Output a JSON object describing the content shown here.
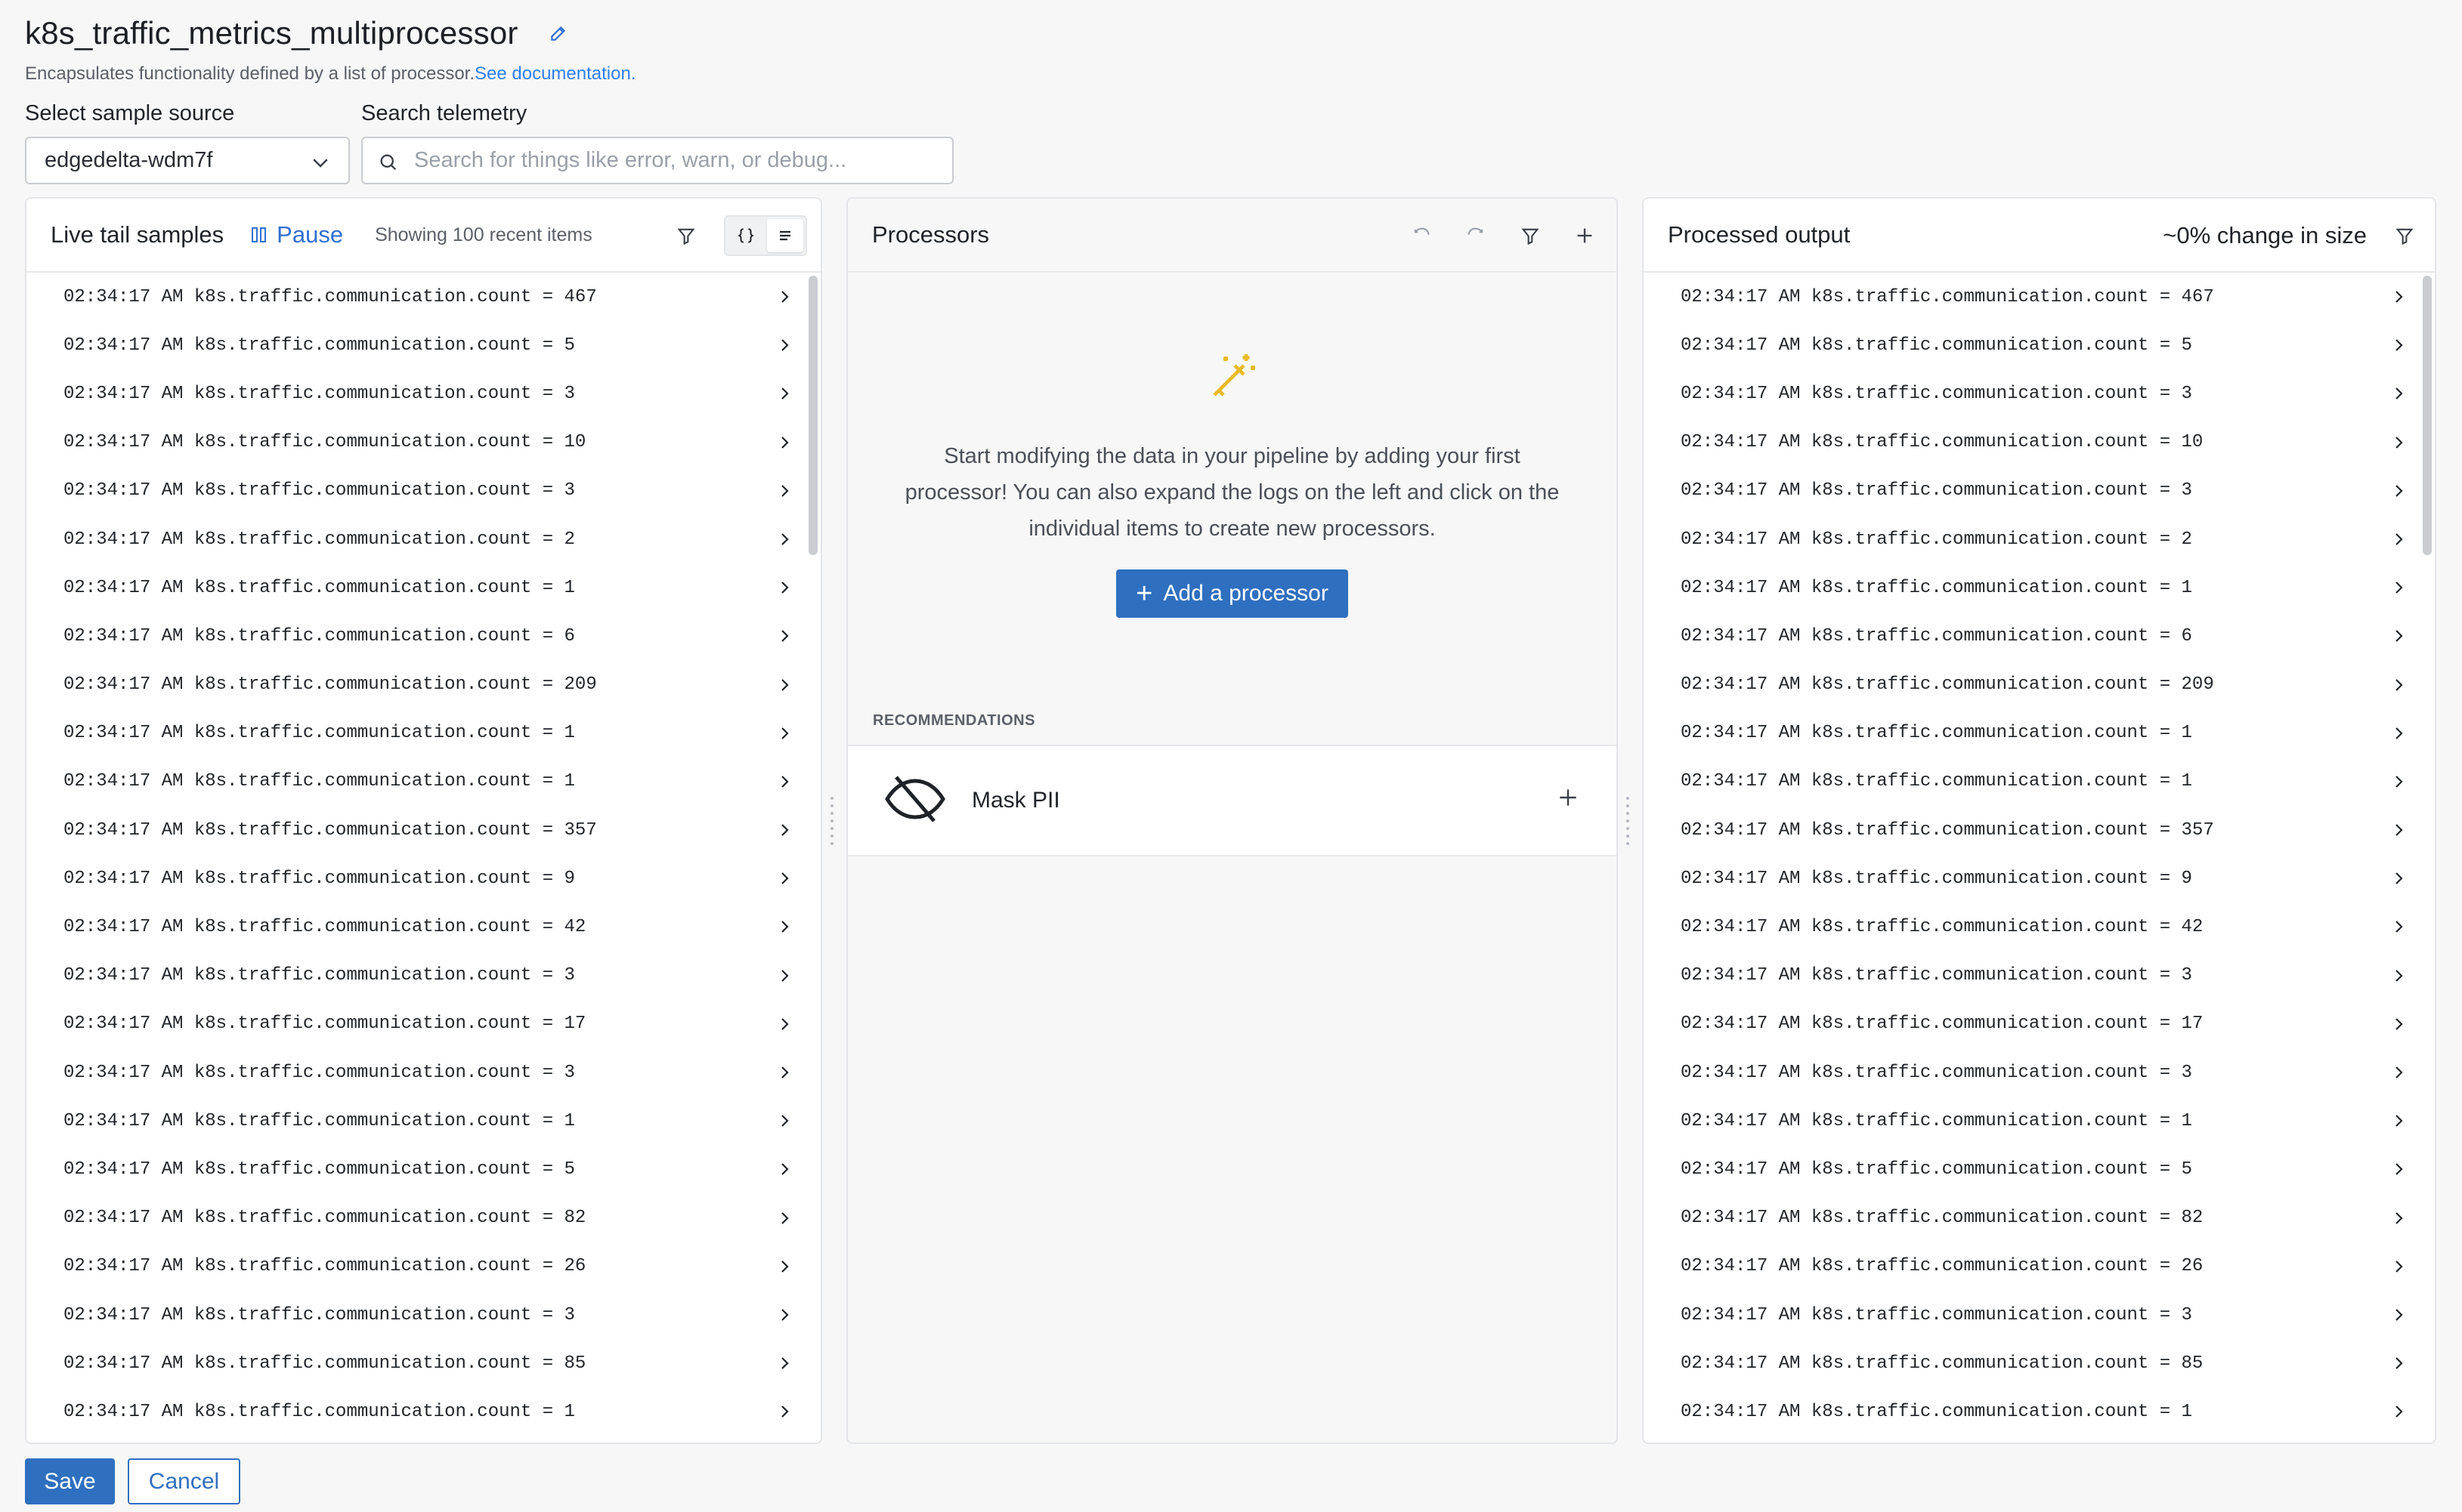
{
  "page": {
    "title": "k8s_traffic_metrics_multiprocessor",
    "subtitle": "Encapsulates functionality defined by a list of processor.",
    "doc_link": "See documentation."
  },
  "sample_source": {
    "label": "Select sample source",
    "value": "edgedelta-wdm7f"
  },
  "search": {
    "label": "Search telemetry",
    "placeholder": "Search for things like error, warn, or debug..."
  },
  "live_tail": {
    "title": "Live tail samples",
    "pause_label": "Pause",
    "showing": "Showing 100 recent items"
  },
  "processors": {
    "title": "Processors",
    "empty_text": "Start modifying the data in your pipeline by adding your first processor! You can also expand the logs on the left and click on the individual items to create new processors.",
    "add_label": "Add a processor",
    "recommendations_label": "RECOMMENDATIONS",
    "recommendations": [
      {
        "name": "Mask PII"
      }
    ]
  },
  "processed_output": {
    "title": "Processed output",
    "change": "~0% change in size"
  },
  "logs": [
    "02:34:17 AM k8s.traffic.communication.count = 467",
    "02:34:17 AM k8s.traffic.communication.count = 5",
    "02:34:17 AM k8s.traffic.communication.count = 3",
    "02:34:17 AM k8s.traffic.communication.count = 10",
    "02:34:17 AM k8s.traffic.communication.count = 3",
    "02:34:17 AM k8s.traffic.communication.count = 2",
    "02:34:17 AM k8s.traffic.communication.count = 1",
    "02:34:17 AM k8s.traffic.communication.count = 6",
    "02:34:17 AM k8s.traffic.communication.count = 209",
    "02:34:17 AM k8s.traffic.communication.count = 1",
    "02:34:17 AM k8s.traffic.communication.count = 1",
    "02:34:17 AM k8s.traffic.communication.count = 357",
    "02:34:17 AM k8s.traffic.communication.count = 9",
    "02:34:17 AM k8s.traffic.communication.count = 42",
    "02:34:17 AM k8s.traffic.communication.count = 3",
    "02:34:17 AM k8s.traffic.communication.count = 17",
    "02:34:17 AM k8s.traffic.communication.count = 3",
    "02:34:17 AM k8s.traffic.communication.count = 1",
    "02:34:17 AM k8s.traffic.communication.count = 5",
    "02:34:17 AM k8s.traffic.communication.count = 82",
    "02:34:17 AM k8s.traffic.communication.count = 26",
    "02:34:17 AM k8s.traffic.communication.count = 3",
    "02:34:17 AM k8s.traffic.communication.count = 85",
    "02:34:17 AM k8s.traffic.communication.count = 1"
  ],
  "footer": {
    "save_label": "Save",
    "cancel_label": "Cancel"
  },
  "colors": {
    "accent": "#2f6fbf",
    "link": "#2f80ed",
    "wand": "#e8b923"
  },
  "icons": {
    "edit": "pencil-icon",
    "chevron": "chevron-down-icon",
    "search": "search-icon",
    "pause": "pause-icon",
    "filter": "filter-icon",
    "json_view": "braces-icon",
    "text_view": "lines-icon",
    "undo": "undo-icon",
    "redo": "redo-icon",
    "add": "plus-icon",
    "wand": "magic-wand-icon",
    "mask": "eye-off-icon",
    "expand": "chevron-right-icon"
  }
}
